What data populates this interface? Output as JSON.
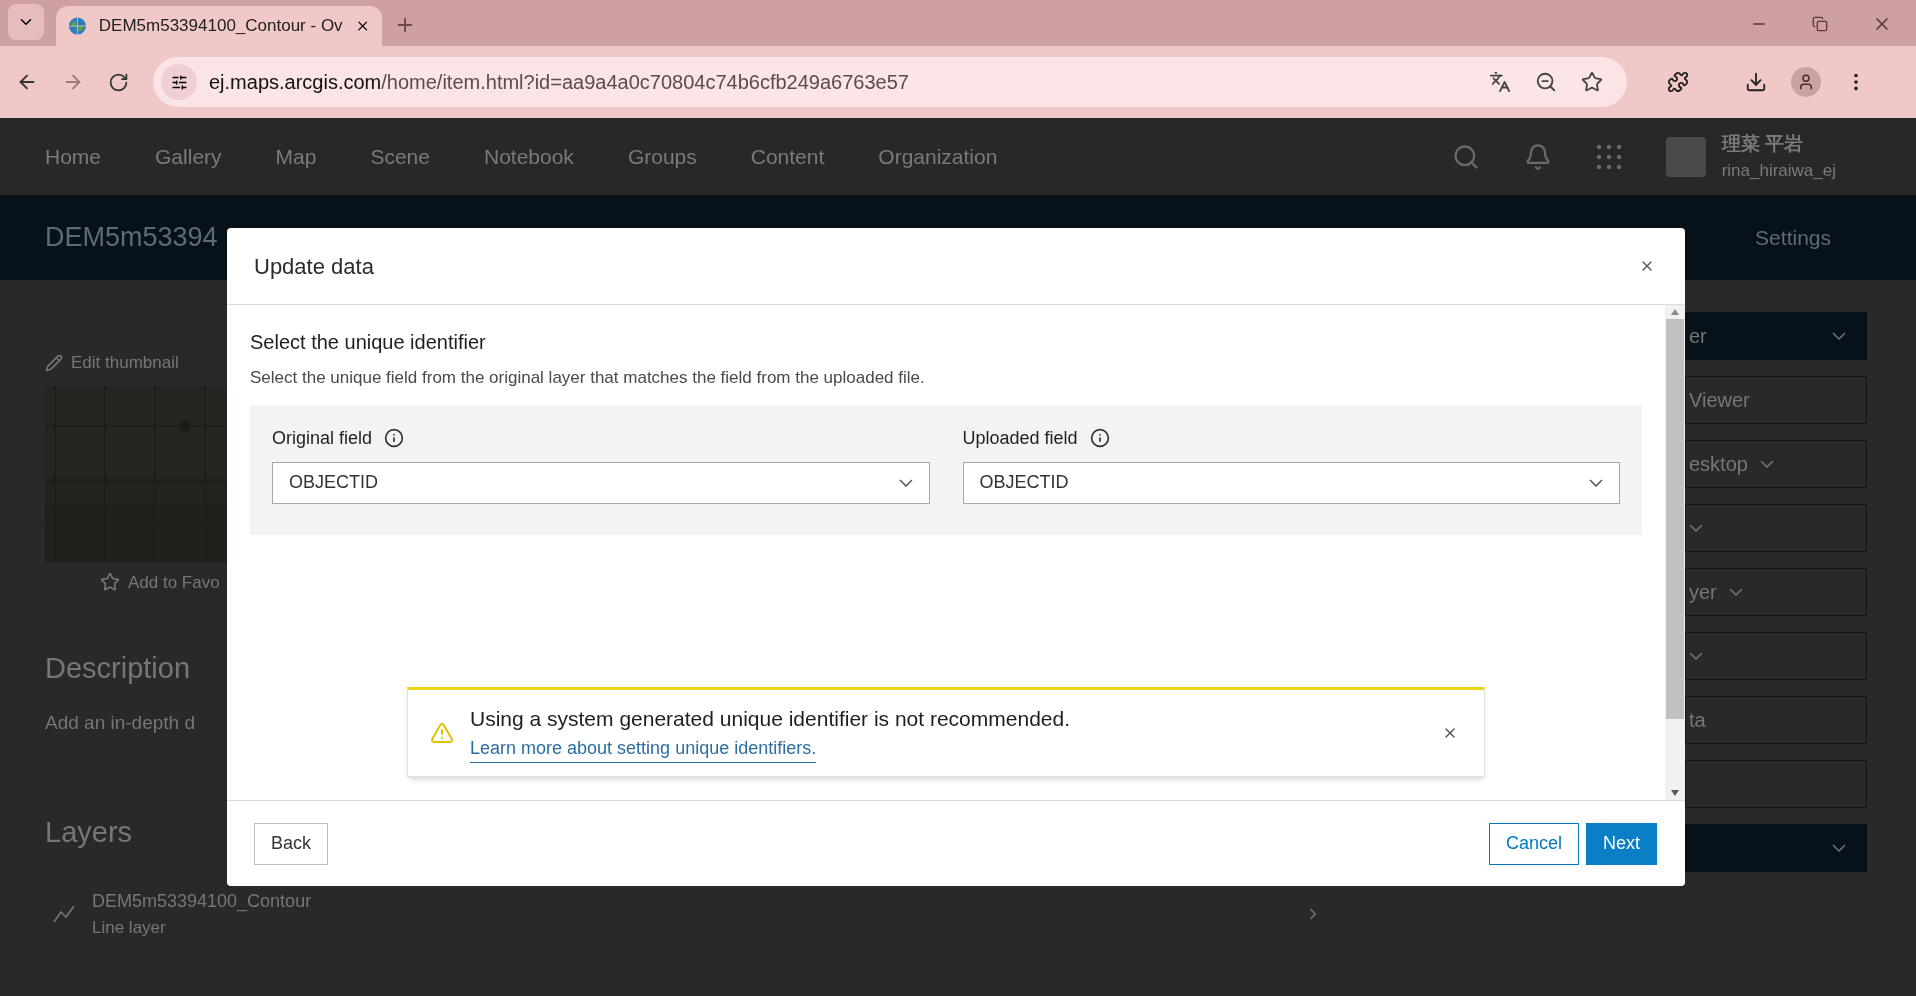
{
  "browser": {
    "tab_title": "DEM5m53394100_Contour - Ov",
    "url_domain": "ej.maps.arcgis.com",
    "url_path": "/home/item.html?id=aa9a4a0c70804c74b6cfb249a6763e57"
  },
  "site_nav": {
    "items": [
      "Home",
      "Gallery",
      "Map",
      "Scene",
      "Notebook",
      "Groups",
      "Content",
      "Organization"
    ],
    "user_name": "理菜 平岩",
    "user_id": "rina_hiraiwa_ej"
  },
  "item_header": {
    "title": "DEM5m53394",
    "settings": "Settings"
  },
  "left_panel": {
    "edit_thumbnail": "Edit thumbnail",
    "add_favorite": "Add to Favo",
    "description_heading": "Description",
    "description_text": "Add an in-depth d",
    "layers_heading": "Layers",
    "layer": {
      "name": "DEM5m53394100_Contour",
      "type": "Line layer"
    }
  },
  "right_buttons": [
    {
      "kind": "primary",
      "label": "er",
      "dropdown": true
    },
    {
      "kind": "outline",
      "label": "Viewer",
      "dropdown": false
    },
    {
      "kind": "outline",
      "label": "esktop",
      "dropdown": true
    },
    {
      "kind": "outline",
      "dropdown": true
    },
    {
      "kind": "outline",
      "label": "yer",
      "dropdown": true
    },
    {
      "kind": "outline",
      "dropdown": true
    },
    {
      "kind": "outline",
      "label": "ta",
      "dropdown": false
    },
    {
      "kind": "outline",
      "dropdown": false
    },
    {
      "kind": "primary",
      "dropdown": true
    }
  ],
  "modal": {
    "title": "Update data",
    "section_title": "Select the unique identifier",
    "section_description": "Select the unique field from the original layer that matches the field from the uploaded file.",
    "fields": [
      {
        "label": "Original field",
        "value": "OBJECTID"
      },
      {
        "label": "Uploaded field",
        "value": "OBJECTID"
      }
    ],
    "notice": {
      "message": "Using a system generated unique identifier is not recommended.",
      "link": "Learn more about setting unique identifiers."
    },
    "buttons": [
      {
        "kind": "secondary",
        "label": "Back"
      },
      {
        "kind": "outline",
        "label": "Cancel"
      },
      {
        "kind": "primary",
        "label": "Next"
      }
    ]
  }
}
